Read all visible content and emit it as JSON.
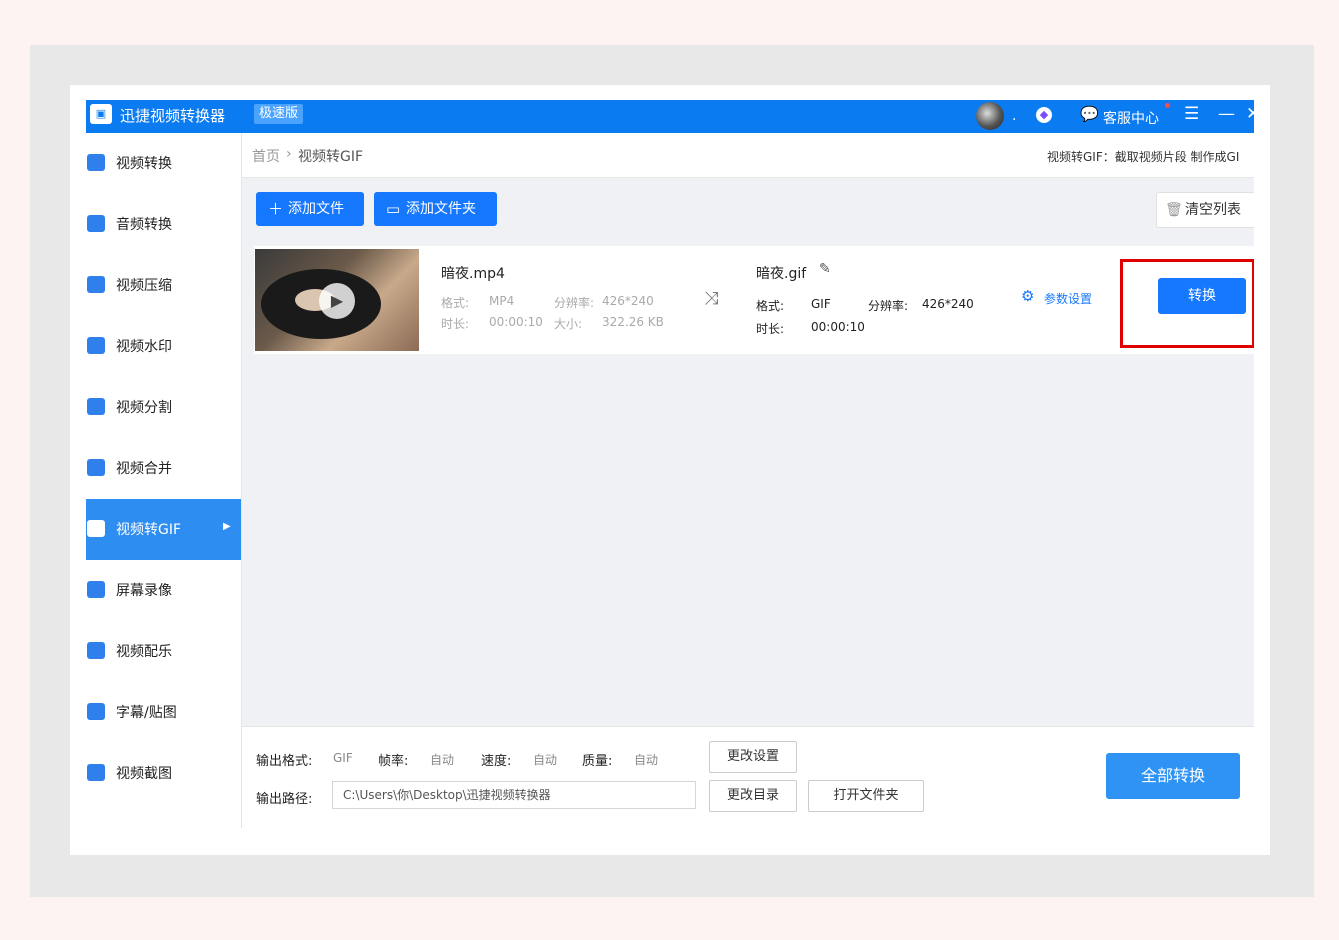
{
  "colors": {
    "accent": "#0b7bf2",
    "button": "#1677ff",
    "highlight": "#e00000",
    "active_item": "#2e8df0"
  },
  "titlebar": {
    "app_name": "迅捷视频转换器",
    "edition": "极速版",
    "service_label": "客服中心",
    "dot": "."
  },
  "sidebar": {
    "items": [
      {
        "label": "视频转换",
        "icon": "video-convert-icon",
        "color": "#2f80ed"
      },
      {
        "label": "音频转换",
        "icon": "audio-convert-icon",
        "color": "#2f80ed"
      },
      {
        "label": "视频压缩",
        "icon": "video-compress-icon",
        "color": "#2f80ed"
      },
      {
        "label": "视频水印",
        "icon": "video-watermark-icon",
        "color": "#2f80ed"
      },
      {
        "label": "视频分割",
        "icon": "video-split-icon",
        "color": "#2f80ed"
      },
      {
        "label": "视频合并",
        "icon": "video-merge-icon",
        "color": "#2f80ed"
      },
      {
        "label": "视频转GIF",
        "icon": "video-gif-icon",
        "color": "#ffffff"
      },
      {
        "label": "屏幕录像",
        "icon": "screen-record-icon",
        "color": "#2f80ed"
      },
      {
        "label": "视频配乐",
        "icon": "video-music-icon",
        "color": "#2f80ed"
      },
      {
        "label": "字幕/贴图",
        "icon": "subtitle-icon",
        "color": "#2f80ed"
      },
      {
        "label": "视频截图",
        "icon": "video-screenshot-icon",
        "color": "#2f80ed"
      }
    ],
    "active_index": 6
  },
  "breadcrumb": {
    "home": "首页",
    "separator": "›",
    "current": "视频转GIF",
    "description": "视频转GIF：截取视频片段 制作成GI"
  },
  "toolbar": {
    "add_file": "添加文件",
    "add_folder": "添加文件夹",
    "clear_list": "清空列表"
  },
  "file": {
    "source_name": "暗夜.mp4",
    "format_label": "格式:",
    "format": "MP4",
    "resolution_label": "分辨率:",
    "resolution": "426*240",
    "duration_label": "时长:",
    "duration": "00:00:10",
    "size_label": "大小:",
    "size": "322.26 KB",
    "output_name": "暗夜.gif",
    "output_format_label": "格式:",
    "output_format": "GIF",
    "output_resolution_label": "分辨率:",
    "output_resolution": "426*240",
    "output_duration_label": "时长:",
    "output_duration": "00:00:10",
    "param_settings": "参数设置",
    "convert": "转换"
  },
  "bottom": {
    "output_format_label": "输出格式:",
    "output_format": "GIF",
    "frame_rate_label": "帧率:",
    "frame_rate": "自动",
    "speed_label": "速度:",
    "speed": "自动",
    "quality_label": "质量:",
    "quality": "自动",
    "change_settings": "更改设置",
    "output_path_label": "输出路径:",
    "output_path": "C:\\Users\\你\\Desktop\\迅捷视频转换器",
    "change_dir": "更改目录",
    "open_folder": "打开文件夹",
    "convert_all": "全部转换"
  }
}
